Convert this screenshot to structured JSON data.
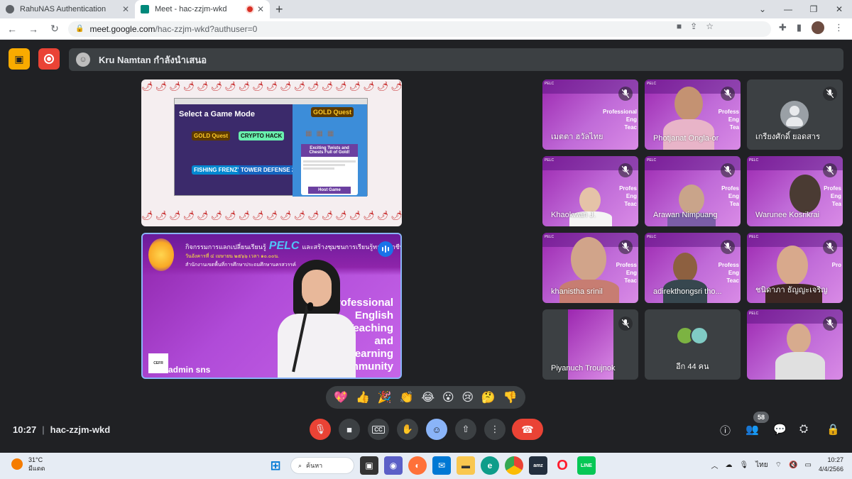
{
  "browser": {
    "tabs": [
      {
        "title": "RahuNAS Authentication",
        "favicon_color": "#5f6368"
      },
      {
        "title": "Meet - hac-zzjm-wkd",
        "favicon_color": "#00897b",
        "recording": true
      }
    ],
    "new_tab": "+",
    "url_host": "meet.google.com",
    "url_path": "/hac-zzjm-wkd?authuser=0"
  },
  "meet": {
    "presenter_label": "Kru Namtan กำลังนำเสนอ",
    "colors": {
      "bg": "#202124",
      "accent": "#8ab4f8",
      "danger": "#ea4335",
      "present": "#f9ab00"
    },
    "shared_screen": {
      "game_heading": "Select a Game Mode",
      "games": [
        "GOLD Quest",
        "CRYPTO HACK",
        "FISHING FRENZY",
        "TOWER DEFENSE 2"
      ],
      "side_logo": "GOLD Quest",
      "side_card_title": "Exciting Twists and Chests Full of Gold!",
      "side_button": "Host Game"
    },
    "speaker": {
      "name": "admin sns",
      "banner_line1_a": "กิจกรรมการแลกเปลี่ยนเรียนรู้",
      "banner_pelc": "PELC",
      "banner_line1_b": "และสร้างชุมชนการเรียนรู้ทางวิชาชีพภาษาอังกฤษ",
      "banner_line2": "วันอังคารที่ ๔ เมษายน ๒๕๖๖ เวลา ๑๐.๐๐น.",
      "banner_line3": "สำนักงานเขตพื้นที่การศึกษาประถมศึกษานครสวรรค์",
      "overlay_lines": [
        "Professional",
        "English",
        "Teaching",
        "and",
        "Learning",
        "Community"
      ],
      "cefr_logo": "CEFR"
    },
    "participants": [
      {
        "name": "เมตตา ฮวัลไทย",
        "style": "purple"
      },
      {
        "name": "Photjanat Ongla-or",
        "style": "purple-face"
      },
      {
        "name": "เกรียงศักดิ์ ยอดสาร",
        "style": "avatar"
      },
      {
        "name": "Khaokwan J.",
        "style": "purple-face"
      },
      {
        "name": "Arawan Nimpuang",
        "style": "purple-face"
      },
      {
        "name": "Warunee Kosrikrai",
        "style": "purple-face"
      },
      {
        "name": "khanistha srinil",
        "style": "purple-face"
      },
      {
        "name": "adirekthongsri tho...",
        "style": "purple-face"
      },
      {
        "name": "ชนิดาภา ธัญญะเจริญ",
        "style": "purple-face"
      },
      {
        "name": "Piyanuch Troujnok",
        "style": "dark-strip"
      },
      {
        "name": "อีก 44 คน",
        "style": "more"
      },
      {
        "name": "",
        "style": "purple-face"
      }
    ],
    "reactions": [
      "💖",
      "👍",
      "🎉",
      "👏",
      "😂",
      "😮",
      "😢",
      "🤔",
      "👎"
    ],
    "bottom": {
      "time": "10:27",
      "meeting_code": "hac-zzjm-wkd",
      "people_count": "58"
    }
  },
  "taskbar": {
    "weather_temp": "31°C",
    "weather_desc": "มีแดด",
    "search_label": "ค้นหา",
    "lang": "ไทย",
    "time": "10:27",
    "date": "4/4/2566"
  }
}
